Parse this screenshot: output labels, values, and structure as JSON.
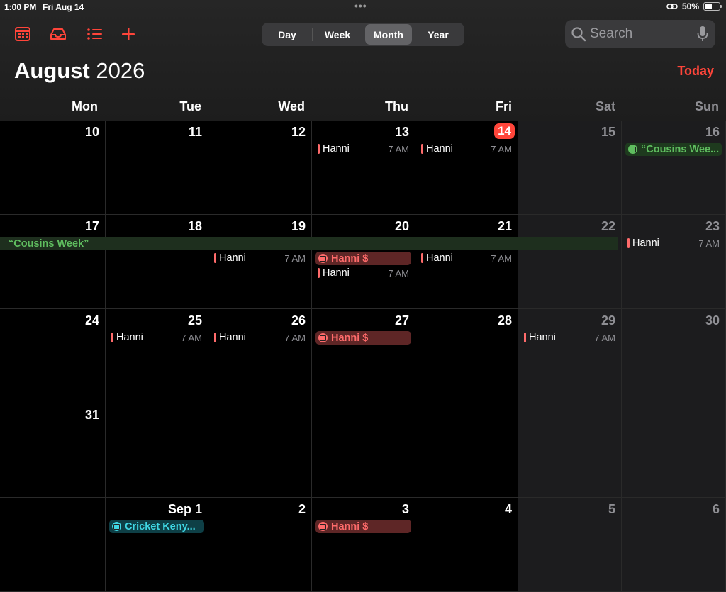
{
  "status": {
    "time": "1:00 PM",
    "date": "Fri Aug 14",
    "battery": "50%",
    "battery_level": 0.5
  },
  "toolbar": {
    "icons": [
      "calendar-icon",
      "inbox-icon",
      "list-icon",
      "plus-icon"
    ]
  },
  "views": {
    "day": "Day",
    "week": "Week",
    "month": "Month",
    "year": "Year",
    "active": "Month"
  },
  "search": {
    "placeholder": "Search"
  },
  "header": {
    "month": "August",
    "year": "2026",
    "today": "Today"
  },
  "weekdays": [
    "Mon",
    "Tue",
    "Wed",
    "Thu",
    "Fri",
    "Sat",
    "Sun"
  ],
  "spanning_event": {
    "label": "“Cousins Week”"
  },
  "weeks": [
    {
      "days": [
        {
          "num": "10",
          "events": []
        },
        {
          "num": "11",
          "events": []
        },
        {
          "num": "12",
          "events": []
        },
        {
          "num": "13",
          "events": [
            {
              "type": "timed",
              "name": "Hanni",
              "time": "7 AM"
            }
          ]
        },
        {
          "num": "14",
          "today": true,
          "events": [
            {
              "type": "timed",
              "name": "Hanni",
              "time": "7 AM"
            }
          ]
        },
        {
          "num": "15",
          "events": []
        },
        {
          "num": "16",
          "events": [
            {
              "type": "pill",
              "color": "green",
              "name": "“Cousins Wee..."
            }
          ]
        }
      ]
    },
    {
      "days": [
        {
          "num": "17",
          "events": []
        },
        {
          "num": "18",
          "events": []
        },
        {
          "num": "19",
          "events": [
            {
              "type": "timed",
              "name": "Hanni",
              "time": "7 AM"
            }
          ]
        },
        {
          "num": "20",
          "events": [
            {
              "type": "pill",
              "color": "red",
              "name": "Hanni $"
            },
            {
              "type": "timed",
              "name": "Hanni",
              "time": "7 AM"
            }
          ]
        },
        {
          "num": "21",
          "events": [
            {
              "type": "timed",
              "name": "Hanni",
              "time": "7 AM"
            }
          ]
        },
        {
          "num": "22",
          "events": []
        },
        {
          "num": "23",
          "events": [
            {
              "type": "timed",
              "name": "Hanni",
              "time": "7 AM",
              "top": true
            }
          ]
        }
      ]
    },
    {
      "days": [
        {
          "num": "24",
          "events": []
        },
        {
          "num": "25",
          "events": [
            {
              "type": "timed",
              "name": "Hanni",
              "time": "7 AM"
            }
          ]
        },
        {
          "num": "26",
          "events": [
            {
              "type": "timed",
              "name": "Hanni",
              "time": "7 AM"
            }
          ]
        },
        {
          "num": "27",
          "events": [
            {
              "type": "pill",
              "color": "red",
              "name": "Hanni $"
            }
          ]
        },
        {
          "num": "28",
          "events": []
        },
        {
          "num": "29",
          "events": [
            {
              "type": "timed",
              "name": "Hanni",
              "time": "7 AM"
            }
          ]
        },
        {
          "num": "30",
          "events": []
        }
      ]
    },
    {
      "days": [
        {
          "num": "31",
          "events": []
        },
        {
          "num": "",
          "events": []
        },
        {
          "num": "",
          "events": []
        },
        {
          "num": "",
          "events": []
        },
        {
          "num": "",
          "events": []
        },
        {
          "num": "",
          "events": []
        },
        {
          "num": "",
          "events": []
        }
      ]
    },
    {
      "days": [
        {
          "num": "",
          "events": []
        },
        {
          "num": "Sep 1",
          "events": [
            {
              "type": "pill",
              "color": "teal",
              "name": "Cricket Keny..."
            }
          ]
        },
        {
          "num": "2",
          "events": []
        },
        {
          "num": "3",
          "events": [
            {
              "type": "pill",
              "color": "red",
              "name": "Hanni $"
            }
          ]
        },
        {
          "num": "4",
          "events": []
        },
        {
          "num": "5",
          "events": []
        },
        {
          "num": "6",
          "events": []
        }
      ]
    }
  ]
}
